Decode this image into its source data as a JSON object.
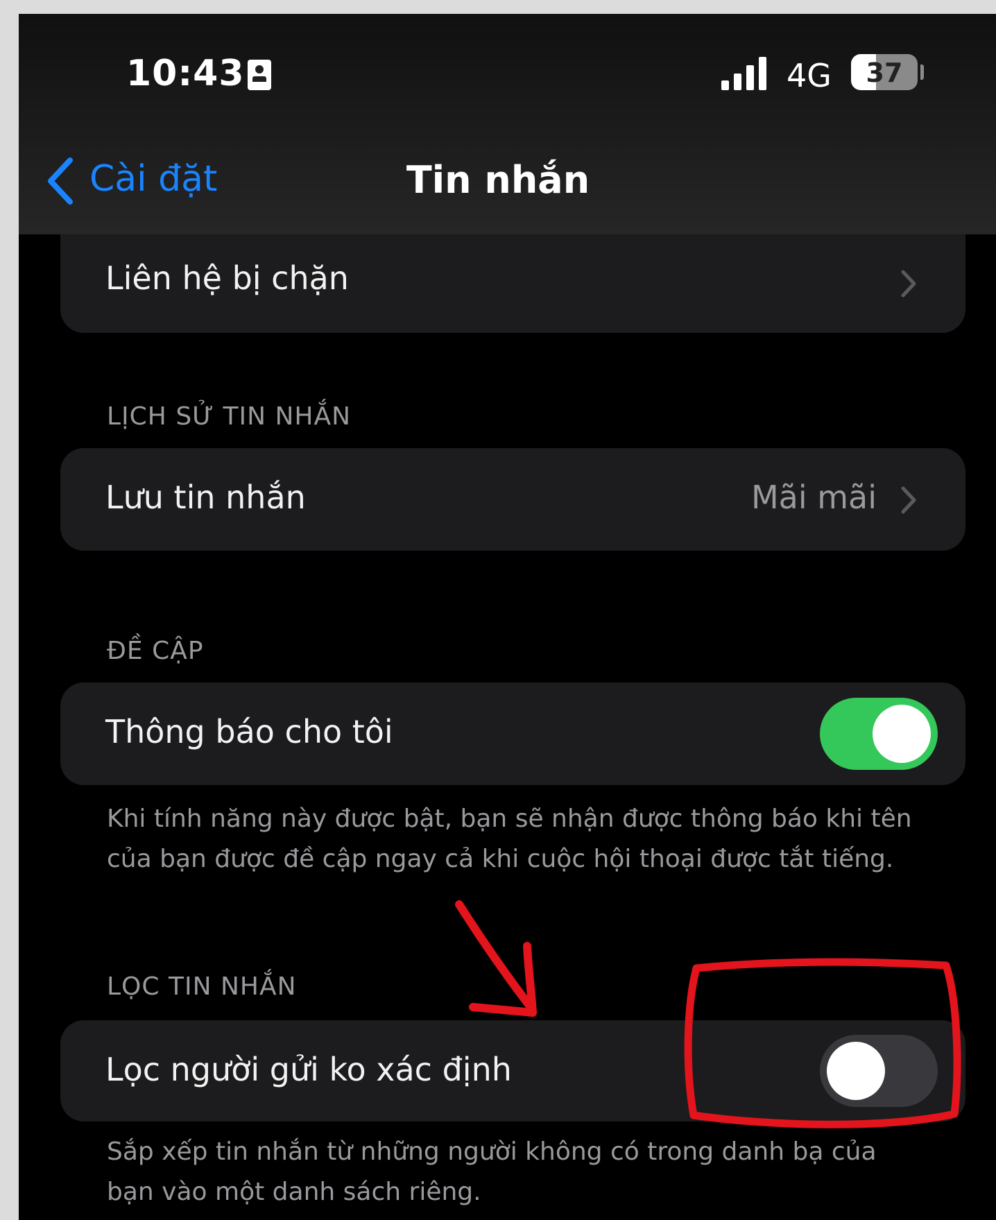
{
  "status_bar": {
    "time": "10:43",
    "network": "4G",
    "battery_level": "37",
    "battery_fraction": 0.37,
    "signal_bars": 4
  },
  "nav": {
    "back_label": "Cài đặt",
    "title": "Tin nhắn"
  },
  "blocked_contacts": {
    "label": "Liên hệ bị chặn"
  },
  "message_history": {
    "header": "LỊCH SỬ TIN NHẮN",
    "keep_messages_label": "Lưu tin nhắn",
    "keep_messages_value": "Mãi mãi"
  },
  "mentions": {
    "header": "ĐỀ CẬP",
    "notify_me_label": "Thông báo cho tôi",
    "notify_me_on": true,
    "footnote": "Khi tính năng này được bật, bạn sẽ nhận được thông báo khi tên của bạn được đề cập ngay cả khi cuộc hội thoại được tắt tiếng."
  },
  "message_filtering": {
    "header": "LỌC TIN NHẮN",
    "filter_unknown_label": "Lọc người gửi ko xác định",
    "filter_unknown_on": false,
    "footnote": "Sắp xếp tin nhắn từ những người không có trong danh bạ của bạn vào một danh sách riêng."
  },
  "colors": {
    "accent_blue": "#1a84ff",
    "toggle_on": "#34c759",
    "toggle_off": "#39393d",
    "annotation_red": "#e3141c"
  }
}
